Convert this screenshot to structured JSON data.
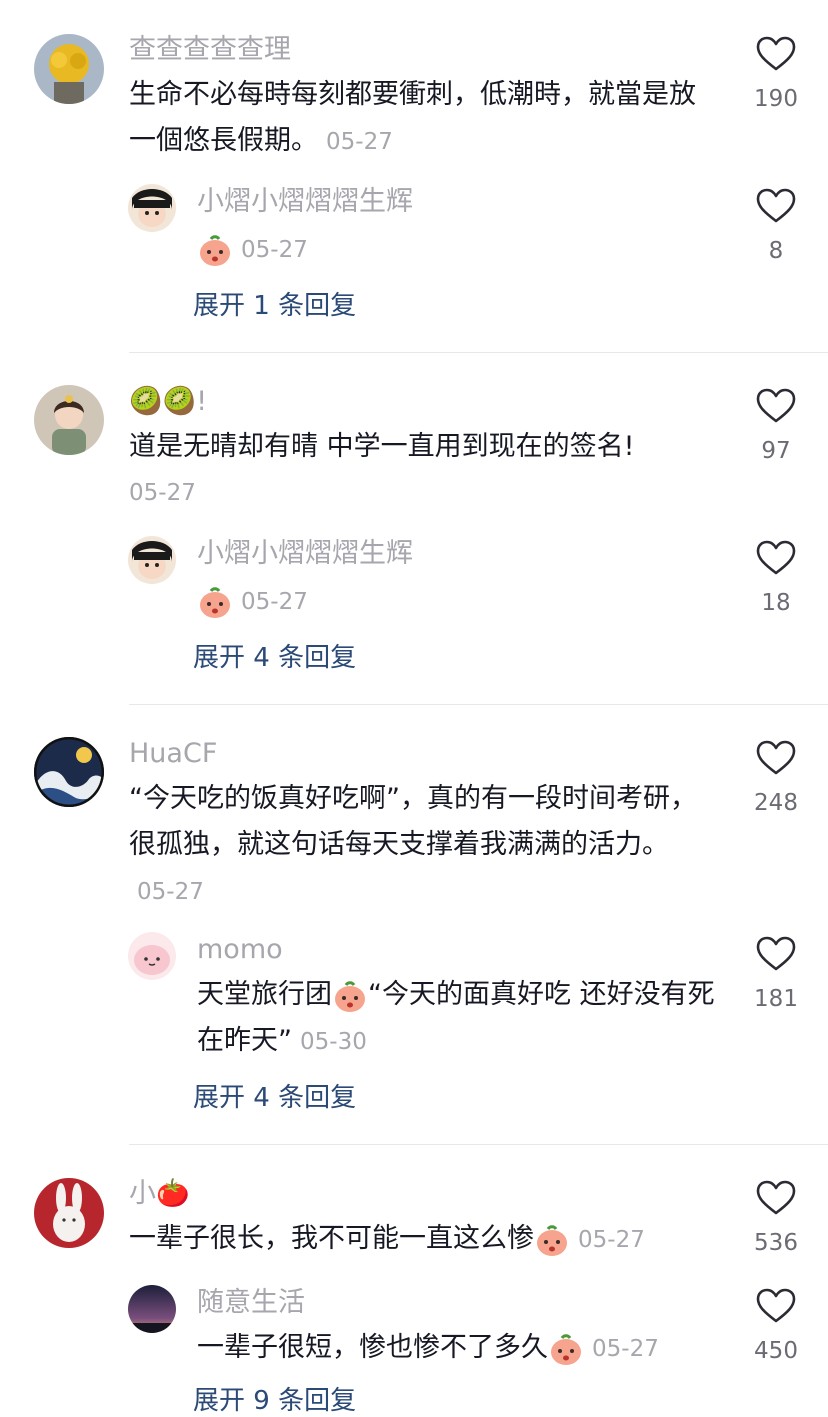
{
  "comments": [
    {
      "author": "查查查查查理",
      "text": "生命不必每時每刻都要衝刺，低潮時，就當是放一個悠長假期。",
      "date": "05-27",
      "likes": "190",
      "reply": {
        "author": "小熠小熠熠熠生辉",
        "text": "",
        "date": "05-27",
        "likes": "8"
      },
      "expand": "展开 1 条回复"
    },
    {
      "author": "🥝🥝!",
      "text": "道是无晴却有晴  中学一直用到现在的签名!",
      "date": "05-27",
      "likes": "97",
      "reply": {
        "author": "小熠小熠熠熠生辉",
        "text": "",
        "date": "05-27",
        "likes": "18"
      },
      "expand": "展开 4 条回复"
    },
    {
      "author": "HuaCF",
      "text": "“今天吃的饭真好吃啊”，真的有一段时间考研，很孤独，就这句话每天支撑着我满满的活力。",
      "date": "05-27",
      "likes": "248",
      "reply": {
        "author": "momo",
        "text_a": "天堂旅行团",
        "text_b": "“今天的面真好吃 还好没有死在昨天”",
        "date": "05-30",
        "likes": "181"
      },
      "expand": "展开 4 条回复"
    },
    {
      "author": "小🍅",
      "text": "一辈子很长，我不可能一直这么惨",
      "date": "05-27",
      "likes": "536",
      "reply": {
        "author": "随意生活",
        "text": "一辈子很短，惨也惨不了多久",
        "date": "05-27",
        "likes": "450"
      },
      "expand": "展开 9 条回复"
    }
  ],
  "colors": {
    "link": "#2b4a77",
    "muted": "#a6a6ad",
    "text": "#161823"
  },
  "icons": {
    "like": "heart-outline-icon",
    "emoji": "peach-face-emoji"
  }
}
